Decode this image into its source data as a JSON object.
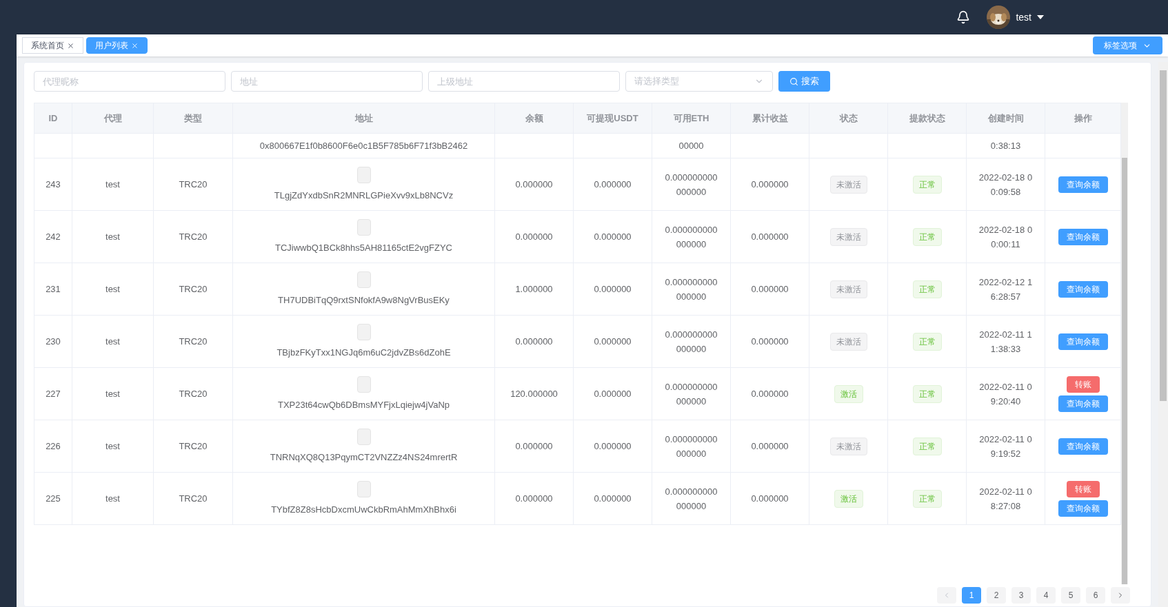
{
  "header": {
    "username": "test"
  },
  "tabs": [
    {
      "label": "系统首页",
      "selected": false
    },
    {
      "label": "用户列表",
      "selected": true
    }
  ],
  "tab_options": {
    "label": "标签选项"
  },
  "filters": {
    "agent": {
      "placeholder": "代理昵称"
    },
    "address": {
      "placeholder": "地址"
    },
    "parent_address": {
      "placeholder": "上级地址"
    },
    "type_select": {
      "placeholder": "请选择类型"
    },
    "search_button": "搜索"
  },
  "table": {
    "columns": [
      "ID",
      "代理",
      "类型",
      "地址",
      "余额",
      "可提现USDT",
      "可用ETH",
      "累计收益",
      "状态",
      "提款状态",
      "创建时间",
      "操作"
    ],
    "partial_row": {
      "address": "0x800667E1f0b8600F6e0c1B5F785b6F71f3bB2462",
      "eth": "00000",
      "created": "0:38:13"
    },
    "rows": [
      {
        "id": "243",
        "agent": "test",
        "type": "TRC20",
        "address": "TLgjZdYxdbSnR2MNRLGPieXvv9xLb8NCVz",
        "balance": "0.000000",
        "usdt": "0.000000",
        "eth": "0.000000000000000",
        "profit": "0.000000",
        "status": {
          "label": "未激活",
          "active": false
        },
        "withdraw": "正常",
        "created": "2022-02-18 00:09:58",
        "actions": [
          {
            "kind": "query",
            "label": "查询余额"
          }
        ]
      },
      {
        "id": "242",
        "agent": "test",
        "type": "TRC20",
        "address": "TCJiwwbQ1BCk8hhs5AH81165ctE2vgFZYC",
        "balance": "0.000000",
        "usdt": "0.000000",
        "eth": "0.000000000000000",
        "profit": "0.000000",
        "status": {
          "label": "未激活",
          "active": false
        },
        "withdraw": "正常",
        "created": "2022-02-18 00:00:11",
        "actions": [
          {
            "kind": "query",
            "label": "查询余额"
          }
        ]
      },
      {
        "id": "231",
        "agent": "test",
        "type": "TRC20",
        "address": "TH7UDBiTqQ9rxtSNfokfA9w8NgVrBusEKy",
        "balance": "1.000000",
        "usdt": "0.000000",
        "eth": "0.000000000000000",
        "profit": "0.000000",
        "status": {
          "label": "未激活",
          "active": false
        },
        "withdraw": "正常",
        "created": "2022-02-12 16:28:57",
        "actions": [
          {
            "kind": "query",
            "label": "查询余额"
          }
        ]
      },
      {
        "id": "230",
        "agent": "test",
        "type": "TRC20",
        "address": "TBjbzFKyTxx1NGJq6m6uC2jdvZBs6dZohE",
        "balance": "0.000000",
        "usdt": "0.000000",
        "eth": "0.000000000000000",
        "profit": "0.000000",
        "status": {
          "label": "未激活",
          "active": false
        },
        "withdraw": "正常",
        "created": "2022-02-11 11:38:33",
        "actions": [
          {
            "kind": "query",
            "label": "查询余额"
          }
        ]
      },
      {
        "id": "227",
        "agent": "test",
        "type": "TRC20",
        "address": "TXP23t64cwQb6DBmsMYFjxLqiejw4jVaNp",
        "balance": "120.000000",
        "usdt": "0.000000",
        "eth": "0.000000000000000",
        "profit": "0.000000",
        "status": {
          "label": "激活",
          "active": true
        },
        "withdraw": "正常",
        "created": "2022-02-11 09:20:40",
        "actions": [
          {
            "kind": "transfer",
            "label": "转账"
          },
          {
            "kind": "query",
            "label": "查询余额"
          }
        ]
      },
      {
        "id": "226",
        "agent": "test",
        "type": "TRC20",
        "address": "TNRNqXQ8Q13PqymCT2VNZZz4NS24mrertR",
        "balance": "0.000000",
        "usdt": "0.000000",
        "eth": "0.000000000000000",
        "profit": "0.000000",
        "status": {
          "label": "未激活",
          "active": false
        },
        "withdraw": "正常",
        "created": "2022-02-11 09:19:52",
        "actions": [
          {
            "kind": "query",
            "label": "查询余额"
          }
        ]
      },
      {
        "id": "225",
        "agent": "test",
        "type": "TRC20",
        "address": "TYbfZ8Z8sHcbDxcmUwCkbRmAhMmXhBhx6i",
        "balance": "0.000000",
        "usdt": "0.000000",
        "eth": "0.000000000000000",
        "profit": "0.000000",
        "status": {
          "label": "激活",
          "active": true
        },
        "withdraw": "正常",
        "created": "2022-02-11 08:27:08",
        "actions": [
          {
            "kind": "transfer",
            "label": "转账"
          },
          {
            "kind": "query",
            "label": "查询余额"
          }
        ]
      }
    ]
  },
  "pagination": {
    "pages": [
      {
        "label": "1",
        "selected": true
      },
      {
        "label": "2",
        "selected": false
      },
      {
        "label": "3",
        "selected": false
      },
      {
        "label": "4",
        "selected": false
      },
      {
        "label": "5",
        "selected": false
      },
      {
        "label": "6",
        "selected": false
      }
    ]
  }
}
